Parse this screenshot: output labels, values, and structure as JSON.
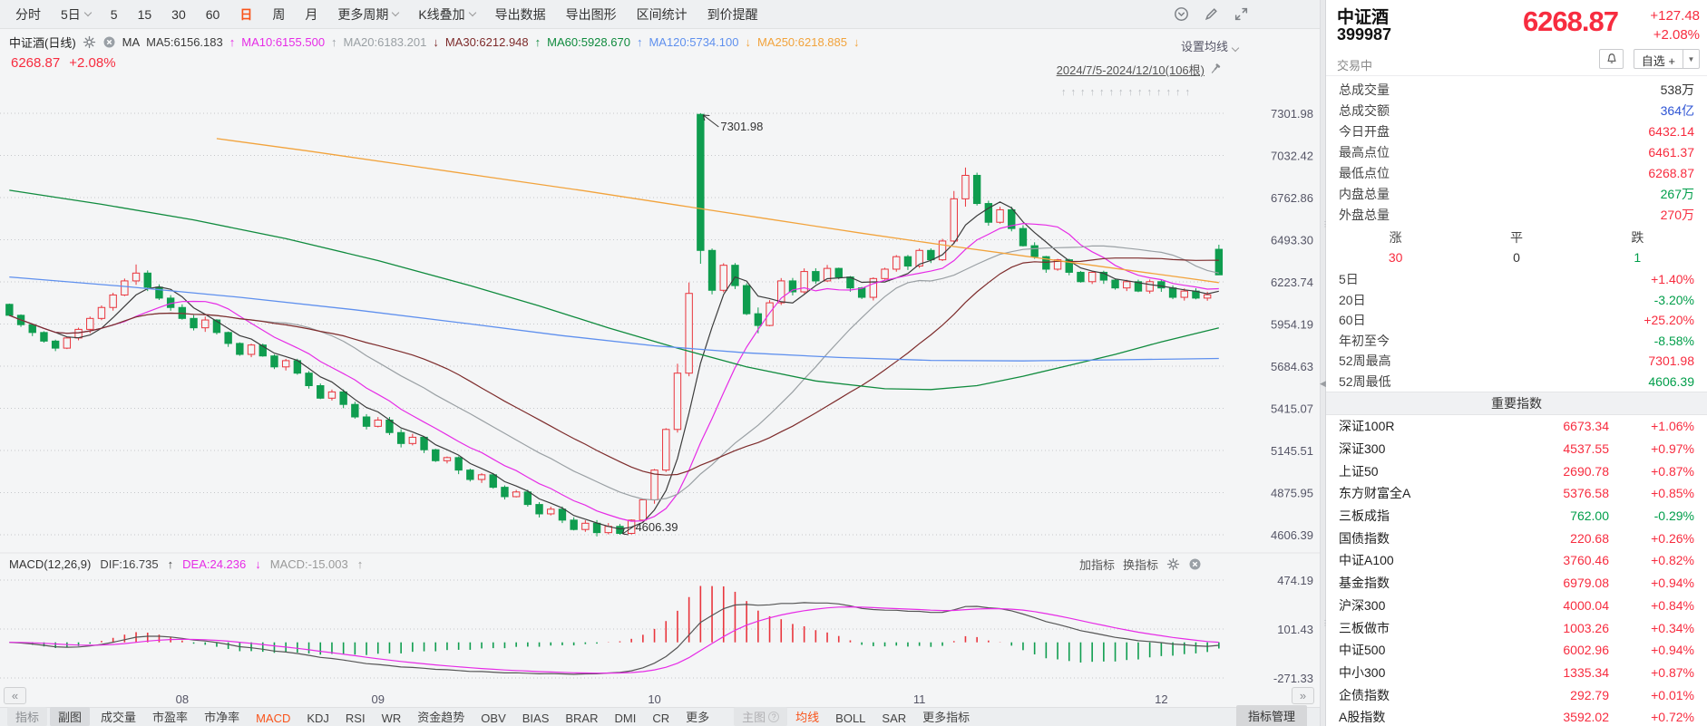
{
  "toolbar": {
    "items": [
      {
        "label": "分时"
      },
      {
        "label": "5日",
        "chevron": true
      },
      {
        "label": "5"
      },
      {
        "label": "15"
      },
      {
        "label": "30"
      },
      {
        "label": "60"
      },
      {
        "label": "日",
        "active": true
      },
      {
        "label": "周"
      },
      {
        "label": "月"
      },
      {
        "label": "更多周期",
        "chevron": true
      },
      {
        "label": "K线叠加",
        "chevron": true
      },
      {
        "label": "导出数据"
      },
      {
        "label": "导出图形"
      },
      {
        "label": "区间统计"
      },
      {
        "label": "到价提醒"
      }
    ],
    "right_icons": [
      "circle-chevron-down-icon",
      "brush-icon",
      "fullscreen-icon"
    ]
  },
  "ma_header": {
    "symbol": "中证酒(日线)",
    "group": "MA",
    "items": [
      {
        "label": "MA5:6156.183",
        "color": "#3c3c3c",
        "arrow": ""
      },
      {
        "label": "MA10:6155.500",
        "color": "#e62ce6",
        "arrow": "↑"
      },
      {
        "label": "MA20:6183.201",
        "color": "#9aa0a4",
        "arrow": "↑"
      },
      {
        "label": "MA30:6212.948",
        "color": "#7d2b2b",
        "arrow": "↓"
      },
      {
        "label": "MA60:5928.670",
        "color": "#108b3e",
        "arrow": "↑"
      },
      {
        "label": "MA120:5734.100",
        "color": "#5f90ee",
        "arrow": "↑"
      },
      {
        "label": "MA250:6218.885",
        "color": "#f2a33c",
        "arrow": "↓",
        "trail": "↓"
      }
    ],
    "settings_label": "设置均线"
  },
  "chart_header": {
    "price": "6268.87",
    "change_pct": "+2.08%"
  },
  "range_label": "2024/7/5-2024/12/10(106根)",
  "event_arrows": {
    "count": 14,
    "glyph": "↑"
  },
  "macd_header": {
    "title": "MACD(12,26,9)",
    "dif": {
      "label": "DIF:16.735",
      "arrow": "↑",
      "color": "#444444"
    },
    "dea": {
      "label": "DEA:24.236",
      "arrow": "↓",
      "color": "#e62ce6"
    },
    "macd": {
      "label": "MACD:-15.003",
      "arrow": "↑",
      "color": "#999999"
    },
    "actions": [
      "加指标",
      "换指标"
    ]
  },
  "bottom_bar": {
    "collapse_left": "«",
    "collapse_right": "»",
    "tabs": [
      {
        "label": "指标",
        "style": "chip-muted"
      },
      {
        "label": "副图",
        "style": "chip"
      },
      {
        "label": "成交量"
      },
      {
        "label": "市盈率"
      },
      {
        "label": "市净率"
      },
      {
        "label": "MACD",
        "style": "active"
      },
      {
        "label": "KDJ"
      },
      {
        "label": "RSI"
      },
      {
        "label": "WR"
      },
      {
        "label": "资金趋势"
      },
      {
        "label": "OBV"
      },
      {
        "label": "BIAS"
      },
      {
        "label": "BRAR"
      },
      {
        "label": "DMI"
      },
      {
        "label": "CR"
      },
      {
        "label": "更多"
      },
      {
        "label": "主图",
        "style": "chip-disabled",
        "help": true
      },
      {
        "label": "均线",
        "style": "active"
      },
      {
        "label": "BOLL"
      },
      {
        "label": "SAR"
      },
      {
        "label": "更多指标"
      }
    ],
    "manage_label": "指标管理"
  },
  "panel": {
    "name": "中证酒",
    "code": "399987",
    "status": "交易中",
    "price": "6268.87",
    "change": "+127.48",
    "change_pct": "+2.08%",
    "watchlist_label": "自选 +",
    "stats": [
      {
        "label": "总成交量",
        "value": "538万",
        "color": "dark"
      },
      {
        "label": "总成交额",
        "value": "364亿",
        "color": "blue"
      },
      {
        "label": "今日开盘",
        "value": "6432.14",
        "color": "red"
      },
      {
        "label": "最高点位",
        "value": "6461.37",
        "color": "red"
      },
      {
        "label": "最低点位",
        "value": "6268.87",
        "color": "red"
      },
      {
        "label": "内盘总量",
        "value": "267万",
        "color": "green"
      },
      {
        "label": "外盘总量",
        "value": "270万",
        "color": "red"
      }
    ],
    "updown": {
      "labels": [
        "涨",
        "平",
        "跌"
      ],
      "values": [
        {
          "v": "30",
          "color": "red"
        },
        {
          "v": "0",
          "color": "dark"
        },
        {
          "v": "1",
          "color": "green"
        }
      ]
    },
    "periods": [
      {
        "label": "5日",
        "value": "+1.40%",
        "color": "red"
      },
      {
        "label": "20日",
        "value": "-3.20%",
        "color": "green"
      },
      {
        "label": "60日",
        "value": "+25.20%",
        "color": "red"
      },
      {
        "label": "年初至今",
        "value": "-8.58%",
        "color": "green"
      },
      {
        "label": "52周最高",
        "value": "7301.98",
        "color": "red"
      },
      {
        "label": "52周最低",
        "value": "4606.39",
        "color": "green"
      }
    ],
    "indices_title": "重要指数",
    "indices": [
      {
        "name": "深证100R",
        "value": "6673.34",
        "pct": "+1.06%",
        "color": "red"
      },
      {
        "name": "深证300",
        "value": "4537.55",
        "pct": "+0.97%",
        "color": "red"
      },
      {
        "name": "上证50",
        "value": "2690.78",
        "pct": "+0.87%",
        "color": "red"
      },
      {
        "name": "东方财富全A",
        "value": "5376.58",
        "pct": "+0.85%",
        "color": "red"
      },
      {
        "name": "三板成指",
        "value": "762.00",
        "pct": "-0.29%",
        "color": "green"
      },
      {
        "name": "国债指数",
        "value": "220.68",
        "pct": "+0.26%",
        "color": "red"
      },
      {
        "name": "中证A100",
        "value": "3760.46",
        "pct": "+0.82%",
        "color": "red"
      },
      {
        "name": "基金指数",
        "value": "6979.08",
        "pct": "+0.94%",
        "color": "red"
      },
      {
        "name": "沪深300",
        "value": "4000.04",
        "pct": "+0.84%",
        "color": "red"
      },
      {
        "name": "三板做市",
        "value": "1003.26",
        "pct": "+0.34%",
        "color": "red"
      },
      {
        "name": "中证500",
        "value": "6002.96",
        "pct": "+0.94%",
        "color": "red"
      },
      {
        "name": "中小300",
        "value": "1335.34",
        "pct": "+0.87%",
        "color": "red"
      },
      {
        "name": "企债指数",
        "value": "292.79",
        "pct": "+0.01%",
        "color": "red"
      },
      {
        "name": "A股指数",
        "value": "3592.02",
        "pct": "+0.72%",
        "color": "red"
      }
    ]
  },
  "chart_data": {
    "type": "candlestick+macd",
    "symbol": "中证酒",
    "code": "399987",
    "period": "日线",
    "range": "2024/7/5-2024/12/10",
    "bars": 106,
    "ohlc_format": "[open, close, high?, low?] — high/low default to body edge plus small wick",
    "up_means": "red hollow (close>=open)",
    "down_means": "green solid (close<open)",
    "y_axis": [
      7301.98,
      7032.42,
      6762.86,
      6493.3,
      6223.74,
      5954.19,
      5684.63,
      5415.07,
      5145.51,
      4875.95,
      4606.39
    ],
    "macd_axis": [
      474.19,
      101.43,
      -271.33
    ],
    "x_axis": [
      {
        "label": "08",
        "bar": 15
      },
      {
        "label": "09",
        "bar": 32
      },
      {
        "label": "10",
        "bar": 56
      },
      {
        "label": "11",
        "bar": 79
      },
      {
        "label": "12",
        "bar": 100
      }
    ],
    "annotations": [
      {
        "text": "7301.98",
        "bar": 60,
        "price": 7301.98,
        "dir": "high"
      },
      {
        "text": "4606.39",
        "bar": 53,
        "price": 4606.39,
        "dir": "low"
      }
    ],
    "candles": [
      [
        6080,
        6010
      ],
      [
        6010,
        5950
      ],
      [
        5950,
        5900
      ],
      [
        5900,
        5845
      ],
      [
        5845,
        5800
      ],
      [
        5800,
        5865
      ],
      [
        5865,
        5920
      ],
      [
        5920,
        5990
      ],
      [
        5990,
        6060
      ],
      [
        6060,
        6140
      ],
      [
        6140,
        6230
      ],
      [
        6230,
        6280,
        6335,
        6205
      ],
      [
        6280,
        6190
      ],
      [
        6190,
        6120
      ],
      [
        6120,
        6060
      ],
      [
        6060,
        5990
      ],
      [
        5990,
        5930
      ],
      [
        5930,
        5980
      ],
      [
        5980,
        5900
      ],
      [
        5900,
        5830
      ],
      [
        5830,
        5760
      ],
      [
        5760,
        5820
      ],
      [
        5820,
        5750
      ],
      [
        5750,
        5680
      ],
      [
        5680,
        5720
      ],
      [
        5720,
        5640
      ],
      [
        5640,
        5560
      ],
      [
        5560,
        5480
      ],
      [
        5480,
        5520
      ],
      [
        5520,
        5440
      ],
      [
        5440,
        5360
      ],
      [
        5360,
        5300
      ],
      [
        5300,
        5340
      ],
      [
        5340,
        5260
      ],
      [
        5260,
        5190
      ],
      [
        5190,
        5230
      ],
      [
        5230,
        5150
      ],
      [
        5150,
        5080
      ],
      [
        5080,
        5100
      ],
      [
        5100,
        5020
      ],
      [
        5020,
        4960
      ],
      [
        4960,
        4990
      ],
      [
        4990,
        4910
      ],
      [
        4910,
        4850
      ],
      [
        4850,
        4880
      ],
      [
        4880,
        4800
      ],
      [
        4800,
        4740
      ],
      [
        4740,
        4770
      ],
      [
        4770,
        4700
      ],
      [
        4700,
        4640
      ],
      [
        4640,
        4680
      ],
      [
        4680,
        4620
      ],
      [
        4620,
        4660
      ],
      [
        4660,
        4615,
        4675,
        4606.39
      ],
      [
        4615,
        4700
      ],
      [
        4700,
        4830
      ],
      [
        4830,
        5020
      ],
      [
        5020,
        5280
      ],
      [
        5280,
        5640,
        5700,
        5260
      ],
      [
        5640,
        6150,
        6220,
        5620
      ],
      [
        7295,
        6425,
        7301.98,
        6340
      ],
      [
        6425,
        6170
      ],
      [
        6170,
        6330
      ],
      [
        6330,
        6200
      ],
      [
        6200,
        6020
      ],
      [
        6020,
        5945,
        6060,
        5895
      ],
      [
        5945,
        6090
      ],
      [
        6090,
        6230
      ],
      [
        6230,
        6160
      ],
      [
        6160,
        6290
      ],
      [
        6290,
        6230
      ],
      [
        6230,
        6310
      ],
      [
        6310,
        6255
      ],
      [
        6255,
        6185
      ],
      [
        6185,
        6125
      ],
      [
        6125,
        6245
      ],
      [
        6245,
        6305
      ],
      [
        6305,
        6385
      ],
      [
        6385,
        6325
      ],
      [
        6325,
        6425
      ],
      [
        6425,
        6365
      ],
      [
        6365,
        6485
      ],
      [
        6485,
        6755,
        6805,
        6465
      ],
      [
        6755,
        6905,
        6955,
        6705
      ],
      [
        6905,
        6725
      ],
      [
        6725,
        6605
      ],
      [
        6605,
        6685
      ],
      [
        6685,
        6565
      ],
      [
        6565,
        6455
      ],
      [
        6455,
        6385
      ],
      [
        6385,
        6305
      ],
      [
        6305,
        6365
      ],
      [
        6365,
        6285
      ],
      [
        6285,
        6225
      ],
      [
        6225,
        6285
      ],
      [
        6285,
        6235
      ],
      [
        6235,
        6185
      ],
      [
        6185,
        6225
      ],
      [
        6225,
        6165
      ],
      [
        6165,
        6225
      ],
      [
        6225,
        6185
      ],
      [
        6185,
        6125
      ],
      [
        6125,
        6165
      ],
      [
        6165,
        6120
      ],
      [
        6120,
        6141.39
      ],
      [
        6432.14,
        6268.87,
        6461.37,
        6268.87
      ]
    ],
    "ma_overlays": {
      "ma60": [
        [
          0,
          6810
        ],
        [
          8,
          6720
        ],
        [
          16,
          6620
        ],
        [
          24,
          6500
        ],
        [
          32,
          6360
        ],
        [
          40,
          6200
        ],
        [
          46,
          6070
        ],
        [
          52,
          5930
        ],
        [
          58,
          5800
        ],
        [
          64,
          5680
        ],
        [
          70,
          5590
        ],
        [
          76,
          5540
        ],
        [
          80,
          5535
        ],
        [
          84,
          5560
        ],
        [
          88,
          5620
        ],
        [
          92,
          5690
        ],
        [
          96,
          5760
        ],
        [
          100,
          5840
        ],
        [
          105,
          5929
        ]
      ],
      "ma120": [
        [
          0,
          6255
        ],
        [
          10,
          6195
        ],
        [
          20,
          6125
        ],
        [
          30,
          6045
        ],
        [
          40,
          5955
        ],
        [
          48,
          5880
        ],
        [
          56,
          5815
        ],
        [
          64,
          5770
        ],
        [
          72,
          5740
        ],
        [
          80,
          5722
        ],
        [
          88,
          5718
        ],
        [
          96,
          5725
        ],
        [
          105,
          5734
        ]
      ],
      "ma250": [
        [
          18,
          7140
        ],
        [
          26,
          7060
        ],
        [
          34,
          6975
        ],
        [
          42,
          6890
        ],
        [
          50,
          6805
        ],
        [
          58,
          6715
        ],
        [
          66,
          6625
        ],
        [
          74,
          6535
        ],
        [
          82,
          6450
        ],
        [
          88,
          6390
        ],
        [
          94,
          6330
        ],
        [
          99,
          6280
        ],
        [
          102,
          6250
        ],
        [
          105,
          6219
        ]
      ]
    },
    "colors": {
      "up": "#e9353d",
      "down": "#0f9d4f",
      "ma5": "#3c3c3c",
      "ma10": "#e62ce6",
      "ma20": "#9aa0a4",
      "ma30": "#7d2b2b",
      "ma60": "#108b3e",
      "ma120": "#5f90ee",
      "ma250": "#f2a33c",
      "dif": "#555555",
      "dea": "#e62ce6"
    },
    "grid": "dotted horizontal lines at each y-axis level"
  }
}
